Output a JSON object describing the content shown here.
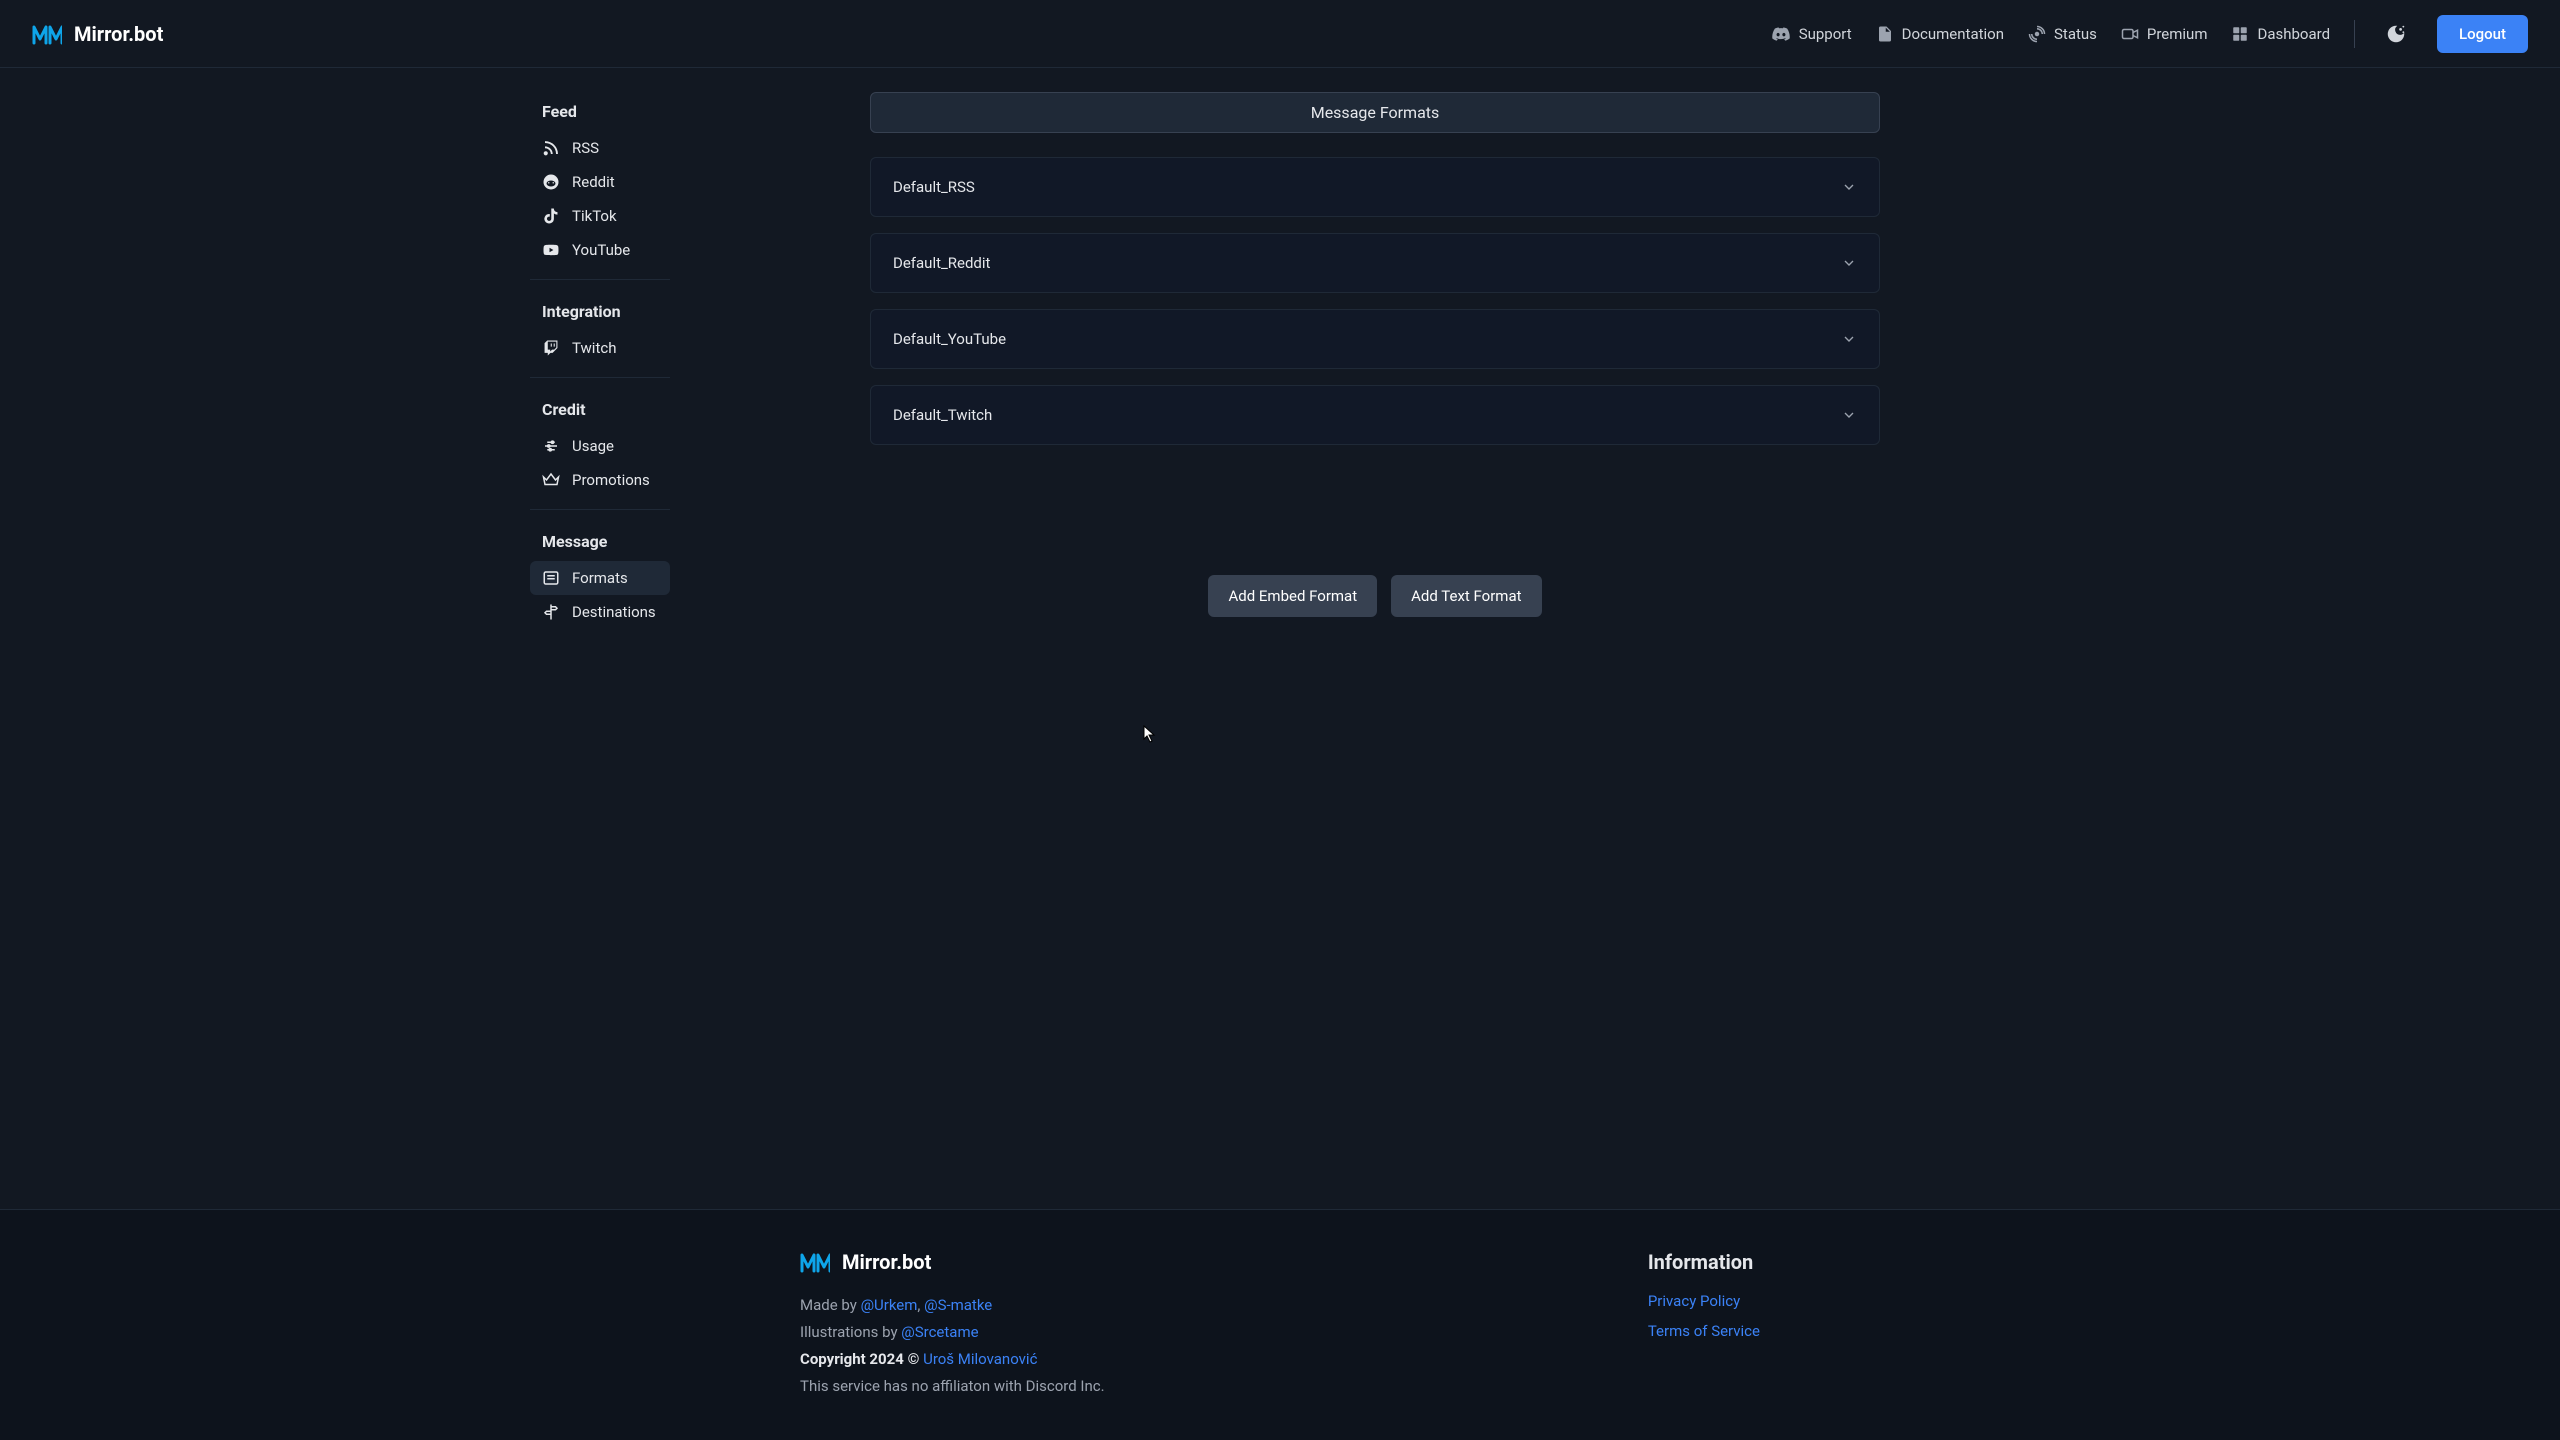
{
  "brand": "Mirror.bot",
  "header": {
    "nav": [
      {
        "label": "Support",
        "icon": "discord"
      },
      {
        "label": "Documentation",
        "icon": "document"
      },
      {
        "label": "Status",
        "icon": "radar"
      },
      {
        "label": "Premium",
        "icon": "premium"
      },
      {
        "label": "Dashboard",
        "icon": "dashboard"
      }
    ],
    "logout": "Logout"
  },
  "sidebar": {
    "sections": [
      {
        "heading": "Feed",
        "items": [
          {
            "label": "RSS",
            "icon": "rss"
          },
          {
            "label": "Reddit",
            "icon": "reddit"
          },
          {
            "label": "TikTok",
            "icon": "tiktok"
          },
          {
            "label": "YouTube",
            "icon": "youtube"
          }
        ]
      },
      {
        "heading": "Integration",
        "items": [
          {
            "label": "Twitch",
            "icon": "twitch"
          }
        ]
      },
      {
        "heading": "Credit",
        "items": [
          {
            "label": "Usage",
            "icon": "usage"
          },
          {
            "label": "Promotions",
            "icon": "crown"
          }
        ]
      },
      {
        "heading": "Message",
        "items": [
          {
            "label": "Formats",
            "icon": "formats",
            "active": true
          },
          {
            "label": "Destinations",
            "icon": "signpost"
          }
        ]
      }
    ]
  },
  "content": {
    "tab_title": "Message Formats",
    "formats": [
      {
        "name": "Default_RSS"
      },
      {
        "name": "Default_Reddit"
      },
      {
        "name": "Default_YouTube"
      },
      {
        "name": "Default_Twitch"
      }
    ],
    "add_embed": "Add Embed Format",
    "add_text": "Add Text Format"
  },
  "footer": {
    "made_by_prefix": "Made by ",
    "author1": "@Urkem",
    "author_sep": ", ",
    "author2": "@S-matke",
    "illustrations_prefix": "Illustrations by ",
    "illustrator": "@Srcetame",
    "copyright_prefix": "Copyright 2024 © ",
    "copyright_name": "Uroš Milovanović",
    "disclaimer": "This service has no affiliaton with Discord Inc.",
    "info_heading": "Information",
    "privacy": "Privacy Policy",
    "terms": "Terms of Service"
  }
}
